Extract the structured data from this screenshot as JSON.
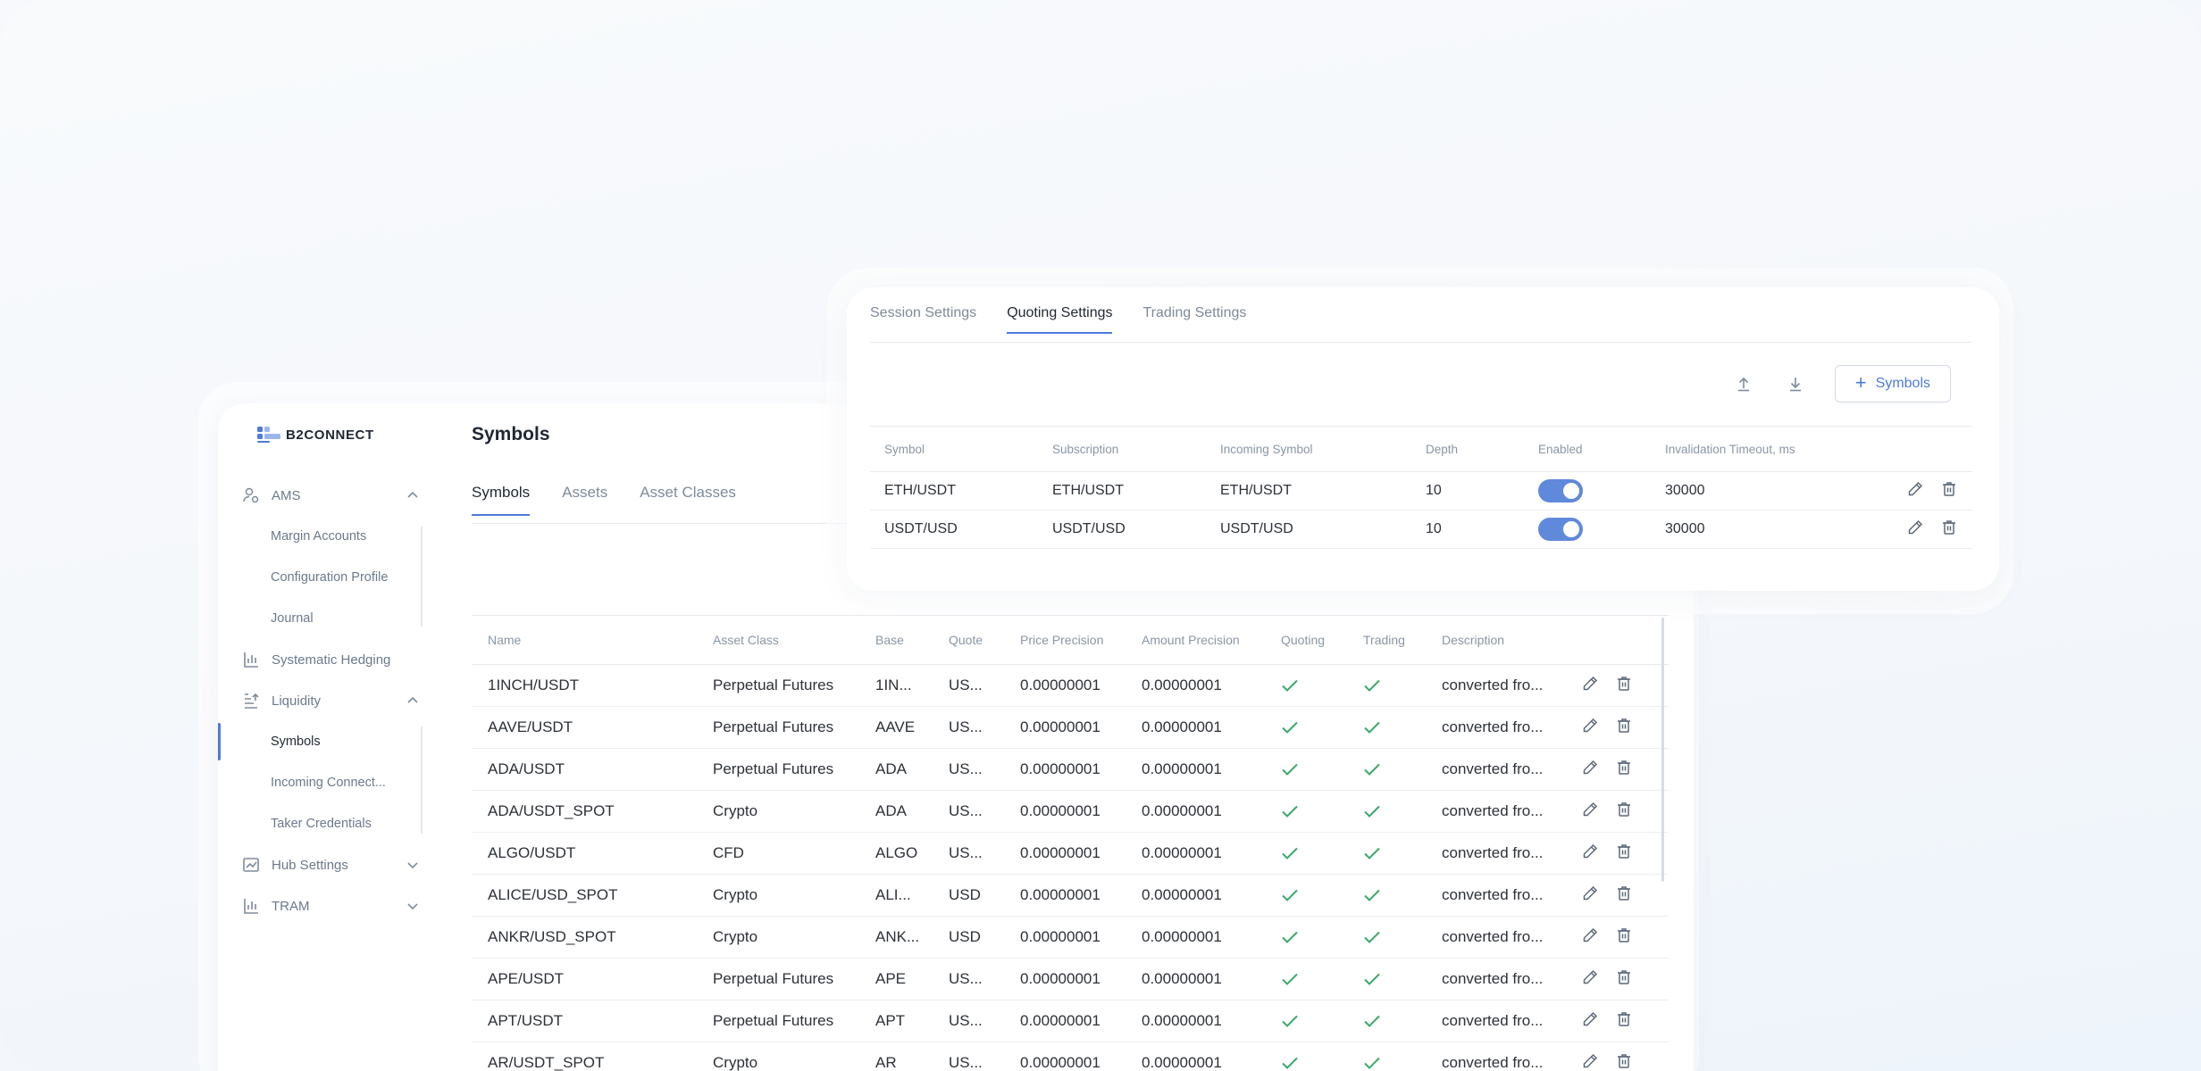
{
  "brand": {
    "name": "B2CONNECT"
  },
  "sidebar": {
    "sections": [
      {
        "label": "AMS",
        "icon": "users-icon",
        "expanded": true,
        "items": [
          "Margin Accounts",
          "Configuration Profile",
          "Journal"
        ]
      },
      {
        "label": "Systematic Hedging",
        "icon": "chart-bars-icon"
      },
      {
        "label": "Liquidity",
        "icon": "liquidity-icon",
        "expanded": true,
        "items": [
          "Symbols",
          "Incoming Connect...",
          "Taker Credentials"
        ]
      },
      {
        "label": "Hub Settings",
        "icon": "chart-line-icon",
        "expanded": false
      },
      {
        "label": "TRAM",
        "icon": "chart-bars-icon",
        "expanded": false
      }
    ],
    "active_item": "Symbols"
  },
  "main": {
    "title": "Symbols",
    "tabs": [
      "Symbols",
      "Assets",
      "Asset Classes"
    ],
    "active_tab": "Symbols"
  },
  "symbols_table": {
    "columns": [
      "Name",
      "Asset Class",
      "Base",
      "Quote",
      "Price Precision",
      "Amount Precision",
      "Quoting",
      "Trading",
      "Description"
    ],
    "rows": [
      {
        "name": "1INCH/USDT",
        "asset_class": "Perpetual Futures",
        "base": "1IN...",
        "quote": "US...",
        "price_precision": "0.00000001",
        "amount_precision": "0.00000001",
        "quoting": true,
        "trading": true,
        "description": "converted fro..."
      },
      {
        "name": "AAVE/USDT",
        "asset_class": "Perpetual Futures",
        "base": "AAVE",
        "quote": "US...",
        "price_precision": "0.00000001",
        "amount_precision": "0.00000001",
        "quoting": true,
        "trading": true,
        "description": "converted fro..."
      },
      {
        "name": "ADA/USDT",
        "asset_class": "Perpetual Futures",
        "base": "ADA",
        "quote": "US...",
        "price_precision": "0.00000001",
        "amount_precision": "0.00000001",
        "quoting": true,
        "trading": true,
        "description": "converted fro..."
      },
      {
        "name": "ADA/USDT_SPOT",
        "asset_class": "Crypto",
        "base": "ADA",
        "quote": "US...",
        "price_precision": "0.00000001",
        "amount_precision": "0.00000001",
        "quoting": true,
        "trading": true,
        "description": "converted fro..."
      },
      {
        "name": "ALGO/USDT",
        "asset_class": "CFD",
        "base": "ALGO",
        "quote": "US...",
        "price_precision": "0.00000001",
        "amount_precision": "0.00000001",
        "quoting": true,
        "trading": true,
        "description": "converted fro..."
      },
      {
        "name": "ALICE/USD_SPOT",
        "asset_class": "Crypto",
        "base": "ALI...",
        "quote": "USD",
        "price_precision": "0.00000001",
        "amount_precision": "0.00000001",
        "quoting": true,
        "trading": true,
        "description": "converted fro..."
      },
      {
        "name": "ANKR/USD_SPOT",
        "asset_class": "Crypto",
        "base": "ANK...",
        "quote": "USD",
        "price_precision": "0.00000001",
        "amount_precision": "0.00000001",
        "quoting": true,
        "trading": true,
        "description": "converted fro..."
      },
      {
        "name": "APE/USDT",
        "asset_class": "Perpetual Futures",
        "base": "APE",
        "quote": "US...",
        "price_precision": "0.00000001",
        "amount_precision": "0.00000001",
        "quoting": true,
        "trading": true,
        "description": "converted fro..."
      },
      {
        "name": "APT/USDT",
        "asset_class": "Perpetual Futures",
        "base": "APT",
        "quote": "US...",
        "price_precision": "0.00000001",
        "amount_precision": "0.00000001",
        "quoting": true,
        "trading": true,
        "description": "converted fro..."
      },
      {
        "name": "AR/USDT_SPOT",
        "asset_class": "Crypto",
        "base": "AR",
        "quote": "US...",
        "price_precision": "0.00000001",
        "amount_precision": "0.00000001",
        "quoting": true,
        "trading": true,
        "description": "converted fro..."
      }
    ]
  },
  "quoting_panel": {
    "tabs": [
      "Session Settings",
      "Quoting Settings",
      "Trading Settings"
    ],
    "active_tab": "Quoting Settings",
    "add_button_label": "Symbols",
    "columns": [
      "Symbol",
      "Subscription",
      "Incoming Symbol",
      "Depth",
      "Enabled",
      "Invalidation Timeout, ms"
    ],
    "rows": [
      {
        "symbol": "ETH/USDT",
        "subscription": "ETH/USDT",
        "incoming_symbol": "ETH/USDT",
        "depth": "10",
        "enabled": true,
        "timeout": "30000"
      },
      {
        "symbol": "USDT/USD",
        "subscription": "USDT/USD",
        "incoming_symbol": "USDT/USD",
        "depth": "10",
        "enabled": true,
        "timeout": "30000"
      }
    ]
  },
  "colors": {
    "accent": "#4d7bd8",
    "check": "#3aa86b",
    "toggle_on": "#5f89db",
    "muted_text": "#7e8b9b"
  }
}
